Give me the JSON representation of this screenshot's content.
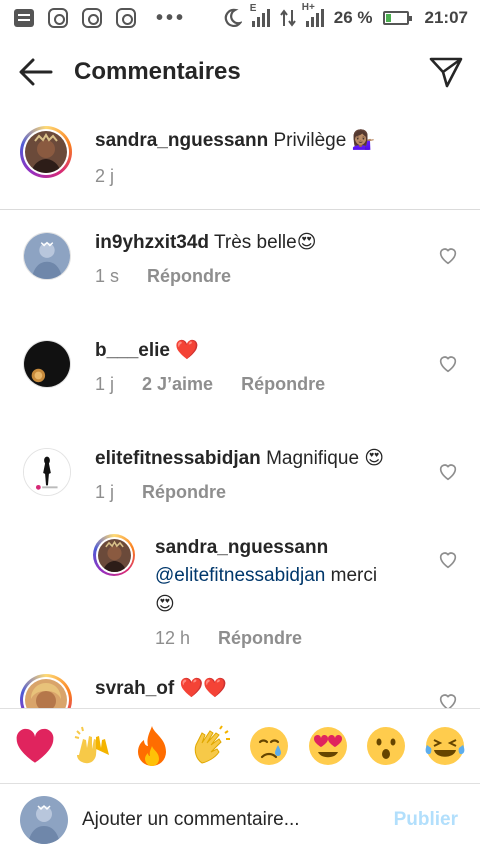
{
  "status_bar": {
    "battery": "26 %",
    "battery_level": 0.26,
    "time": "21:07",
    "dots": "•••",
    "network_labels": [
      "E",
      "H+"
    ]
  },
  "header": {
    "title": "Commentaires",
    "back_icon": "arrow-left-icon",
    "send_icon": "paper-plane-icon"
  },
  "caption": {
    "username": "sandra_nguessann",
    "text": "Privilège",
    "emoji": "💁🏽‍♀️",
    "time": "2 j"
  },
  "comments": [
    {
      "username": "in9yhzxit34d",
      "text": "Très belle",
      "emoji": "😍",
      "time": "1 s",
      "likes": "",
      "reply_label": "Répondre"
    },
    {
      "username": "b___elie",
      "text": "",
      "emoji": "❤️",
      "time": "1 j",
      "likes": "2 J’aime",
      "reply_label": "Répondre"
    },
    {
      "username": "elitefitnessabidjan",
      "text": "Magnifique",
      "emoji": "😍",
      "time": "1 j",
      "likes": "",
      "reply_label": "Répondre"
    },
    {
      "username": "sandra_nguessann",
      "mention": "@elitefitnessabidjan",
      "text": "merci",
      "emoji": "😍",
      "time": "12 h",
      "likes": "",
      "reply_label": "Répondre"
    },
    {
      "username": "svrah_of",
      "text": "",
      "emoji": "❤️❤️",
      "time": "",
      "likes": "",
      "reply_label": ""
    }
  ],
  "emoji_bar": [
    "❤️",
    "🙌",
    "🔥",
    "👏",
    "😢",
    "😍",
    "😮",
    "😂"
  ],
  "composer": {
    "placeholder": "Ajouter un commentaire...",
    "publish_label": "Publier"
  },
  "colors": {
    "text": "#262626",
    "secondary": "#8e8e8e",
    "publish_disabled": "#b2dffc",
    "mention": "#00376b",
    "divider": "#dbdbdb"
  }
}
